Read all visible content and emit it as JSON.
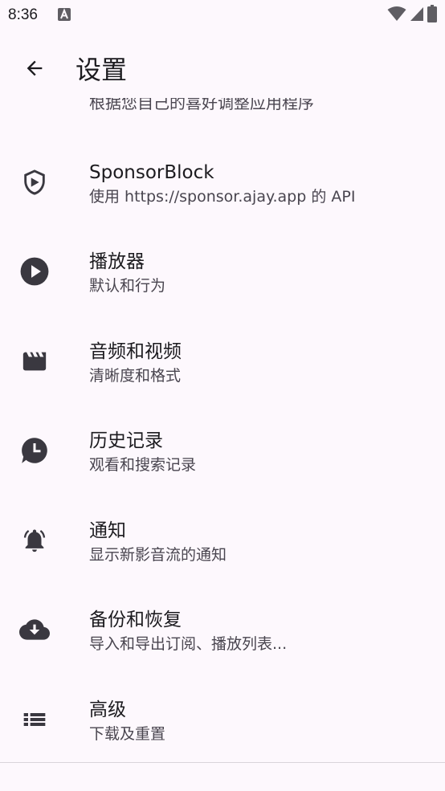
{
  "status_bar": {
    "time": "8:36",
    "notification_icon": "text-a-notification-icon",
    "wifi_icon": "wifi-icon",
    "signal_icon": "cell-signal-icon",
    "battery_icon": "battery-icon"
  },
  "top_bar": {
    "back_icon": "arrow-back-icon",
    "title": "设置"
  },
  "previous_item": {
    "summary": "根据您自己的喜好调整应用程序"
  },
  "settings": [
    {
      "icon": "shield-icon",
      "title": "SponsorBlock",
      "summary": "使用 https://sponsor.ajay.app 的 API"
    },
    {
      "icon": "play-circle-icon",
      "title": "播放器",
      "summary": "默认和行为"
    },
    {
      "icon": "movie-clapper-icon",
      "title": "音频和视频",
      "summary": "清晰度和格式"
    },
    {
      "icon": "history-chat-clock-icon",
      "title": "历史记录",
      "summary": "观看和搜索记录"
    },
    {
      "icon": "bell-icon",
      "title": "通知",
      "summary": "显示新影音流的通知"
    },
    {
      "icon": "cloud-download-icon",
      "title": "备份和恢复",
      "summary": "导入和导出订阅、播放列表..."
    },
    {
      "icon": "list-icon",
      "title": "高级",
      "summary": "下载及重置"
    }
  ],
  "colors": {
    "background": "#fdf8fd",
    "icon": "#3a3840",
    "text_primary": "#1c1b1f",
    "text_secondary": "#49454f"
  }
}
